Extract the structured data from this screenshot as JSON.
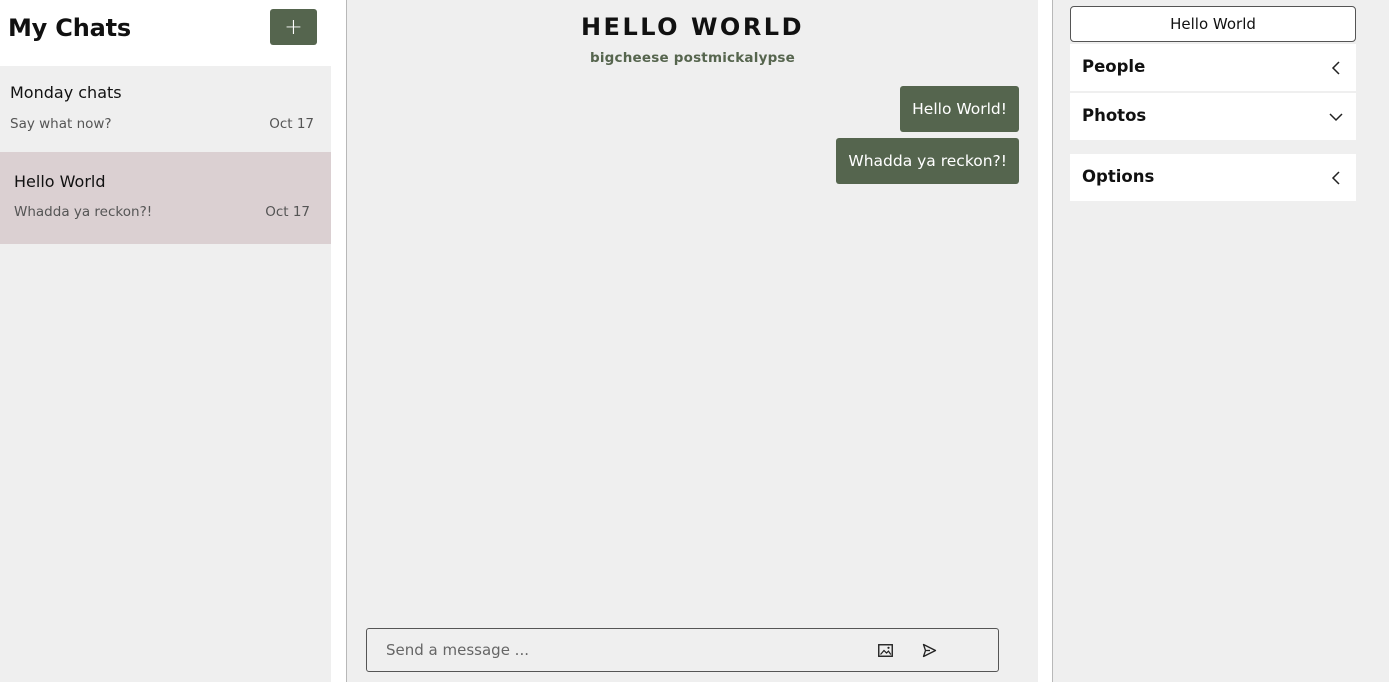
{
  "sidebar": {
    "title": "My Chats",
    "new_chat_label": "+",
    "chats": [
      {
        "name": "Monday chats",
        "preview": "Say what now?",
        "date": "Oct 17",
        "active": false
      },
      {
        "name": "Hello World",
        "preview": "Whadda ya reckon?!",
        "date": "Oct 17",
        "active": true
      }
    ]
  },
  "chat": {
    "title": "HELLO WORLD",
    "participants": "bigcheese postmickalypse",
    "messages": [
      {
        "text": "Hello World!"
      },
      {
        "text": "Whadda ya reckon?!"
      }
    ],
    "composer": {
      "placeholder": "Send a message ...",
      "image_icon": "image-icon",
      "send_icon": "send-icon"
    }
  },
  "details": {
    "room_name": "Hello World",
    "sections": [
      {
        "label": "People",
        "state": "collapsed"
      },
      {
        "label": "Photos",
        "state": "expanded"
      },
      {
        "label": "Options",
        "state": "collapsed"
      }
    ]
  },
  "colors": {
    "accent": "#55654e",
    "active_chat": "#dbd0d2",
    "panel_bg": "#efefef"
  }
}
